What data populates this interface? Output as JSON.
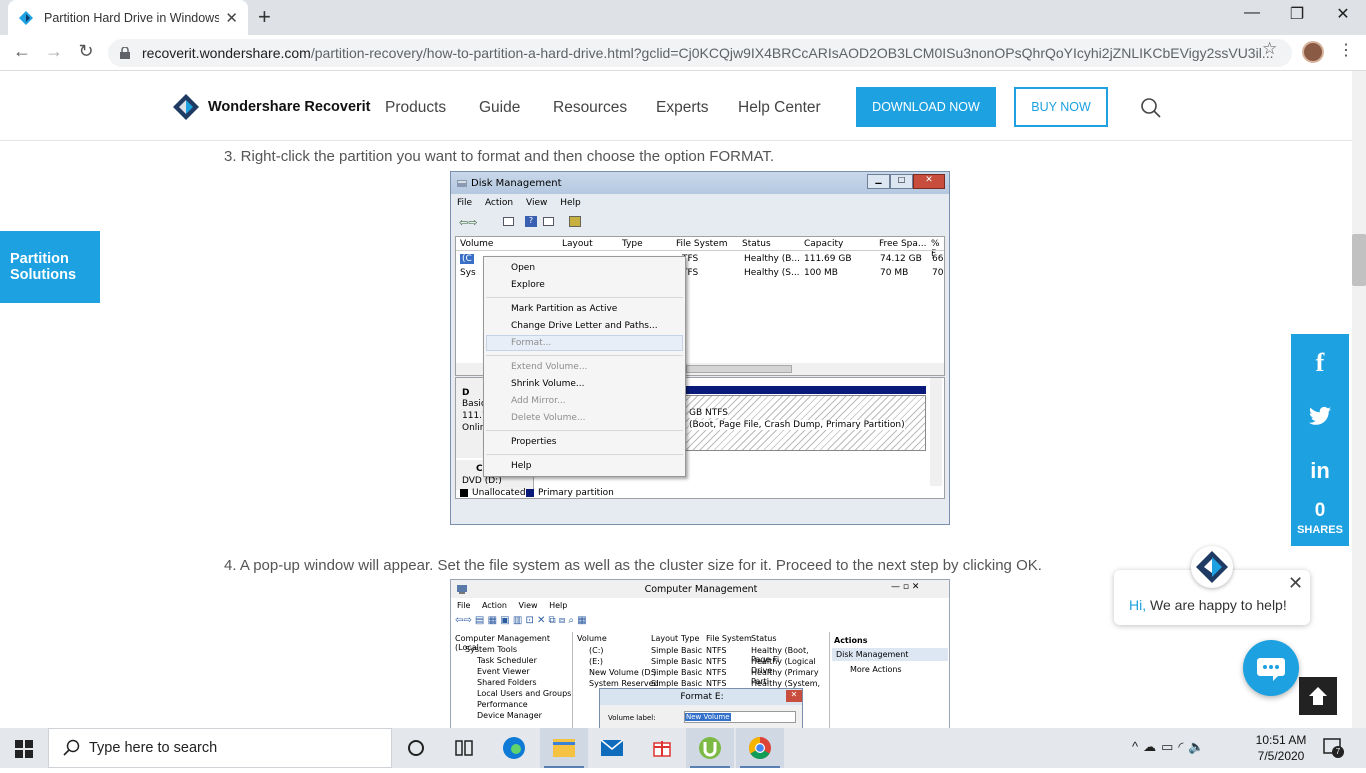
{
  "browser": {
    "tab_title": "Partition Hard Drive in Windows",
    "url_host": "recoverit.wondershare.com",
    "url_path": "/partition-recovery/how-to-partition-a-hard-drive.html?gclid=Cj0KCQjw9IX4BRCcARIsAOD2OB3LCM0ISu3nonOPsQhrQoYIcyhi2jZNLIKCbEVigy2ssVU3il..."
  },
  "site": {
    "logo_text": "Wondershare Recoverit",
    "nav": [
      "Products",
      "Guide",
      "Resources",
      "Experts",
      "Help Center"
    ],
    "download_label": "DOWNLOAD NOW",
    "buy_label": "BUY NOW",
    "brand_color": "#1da1e0"
  },
  "content": {
    "step3": "3. Right-click the partition you want to format and then choose the option FORMAT.",
    "step4": "4. A pop-up window will appear. Set the file system as well as the cluster size for it. Proceed to the next step by clicking OK."
  },
  "side_tag": "Partition Solutions",
  "social": {
    "count": "0",
    "label": "SHARES"
  },
  "chat": {
    "hi": "Hi,",
    "message": " We are happy to help!"
  },
  "disk_mgmt": {
    "title": "Disk Management",
    "menu": [
      "File",
      "Action",
      "View",
      "Help"
    ],
    "columns": [
      "Volume",
      "Layout",
      "Type",
      "File System",
      "Status",
      "Capacity",
      "Free Spa...",
      "% F"
    ],
    "rows": [
      {
        "vol": "(C",
        "fs": "TFS",
        "status": "Healthy (B...",
        "cap": "111.69 GB",
        "free": "74.12 GB",
        "pct": "66"
      },
      {
        "vol": "Sys",
        "fs": "TFS",
        "status": "Healthy (S...",
        "cap": "100 MB",
        "free": "70 MB",
        "pct": "70"
      }
    ],
    "disk0": [
      "D",
      "Basic",
      "111.7",
      "Onlin"
    ],
    "partition_text": [
      "GB NTFS",
      "(Boot, Page File, Crash Dump, Primary Partition)"
    ],
    "cdrom": [
      "C",
      "DVD (D:)"
    ],
    "legend": [
      "Unallocated",
      "Primary partition"
    ],
    "context_menu": [
      {
        "label": "Open",
        "disabled": false
      },
      {
        "label": "Explore",
        "disabled": false
      },
      {
        "label": "Mark Partition as Active",
        "disabled": false
      },
      {
        "label": "Change Drive Letter and Paths...",
        "disabled": false
      },
      {
        "label": "Format...",
        "disabled": true
      },
      {
        "label": "Extend Volume...",
        "disabled": true
      },
      {
        "label": "Shrink Volume...",
        "disabled": false
      },
      {
        "label": "Add Mirror...",
        "disabled": true
      },
      {
        "label": "Delete Volume...",
        "disabled": true
      },
      {
        "label": "Properties",
        "disabled": false
      },
      {
        "label": "Help",
        "disabled": false
      }
    ]
  },
  "comp_mgmt": {
    "title": "Computer Management",
    "menu": [
      "File",
      "Action",
      "View",
      "Help"
    ],
    "tree": [
      "Computer Management (Local",
      "System Tools",
      "Task Scheduler",
      "Event Viewer",
      "Shared Folders",
      "Local Users and Groups",
      "Performance",
      "Device Manager"
    ],
    "columns": [
      "Volume",
      "Layout",
      "Type",
      "File System",
      "Status"
    ],
    "rows": [
      [
        "(C:)",
        "Simple",
        "Basic",
        "NTFS",
        "Healthy (Boot, Page Fi"
      ],
      [
        "(E:)",
        "Simple",
        "Basic",
        "NTFS",
        "Healthy (Logical Drive"
      ],
      [
        "New Volume (D:)",
        "Simple",
        "Basic",
        "NTFS",
        "Healthy (Primary Parti"
      ],
      [
        "System Reserved",
        "Simple",
        "Basic",
        "NTFS",
        "Healthy (System, Activ"
      ]
    ],
    "actions_title": "Actions",
    "actions_item": "Disk Management",
    "more_actions": "More Actions",
    "format_title": "Format E:",
    "volume_label": "Volume label:",
    "volume_value": "New Volume"
  },
  "taskbar": {
    "search_placeholder": "Type here to search",
    "time": "10:51 AM",
    "date": "7/5/2020",
    "notif_count": "7"
  }
}
